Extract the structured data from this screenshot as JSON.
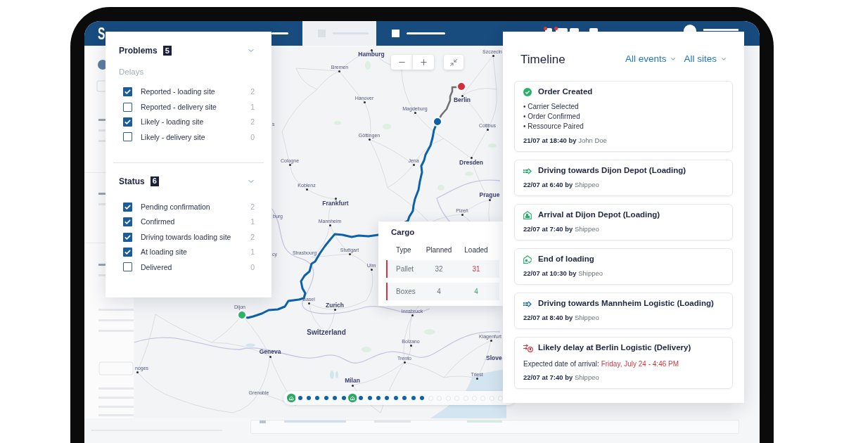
{
  "nav": {
    "logo": "S",
    "tabs": [
      {
        "selected": false
      },
      {
        "selected": true
      },
      {
        "selected": false
      }
    ],
    "icons": [
      {
        "alert": true
      },
      {
        "alert": true
      },
      {
        "alert": false
      },
      {
        "alert": false
      }
    ]
  },
  "filters": {
    "sections": [
      {
        "title": "Problems",
        "count": "5",
        "expanded": true,
        "subheading": "Delays",
        "items": [
          {
            "label": "Reported - loading site",
            "count": "2",
            "checked": true
          },
          {
            "label": "Reported - delivery site",
            "count": "1",
            "checked": false
          },
          {
            "label": "Likely - loading site",
            "count": "2",
            "checked": true
          },
          {
            "label": "Likely - delivery site",
            "count": "0",
            "checked": false
          }
        ]
      },
      {
        "title": "Status",
        "count": "6",
        "expanded": true,
        "items": [
          {
            "label": "Pending confirmation",
            "count": "2",
            "checked": true
          },
          {
            "label": "Confirmed",
            "count": "1",
            "checked": true
          },
          {
            "label": "Driving towards loading site",
            "count": "2",
            "checked": true
          },
          {
            "label": "At loading site",
            "count": "1",
            "checked": true
          },
          {
            "label": "Delivered",
            "count": "0",
            "checked": false
          }
        ]
      }
    ]
  },
  "map": {
    "labels": [
      {
        "text": "Hamburg",
        "kind": "major"
      },
      {
        "text": "Bremen",
        "kind": "minor"
      },
      {
        "text": "Hanover",
        "kind": "minor"
      },
      {
        "text": "Magdeburg",
        "kind": "minor"
      },
      {
        "text": "Berlin",
        "kind": "major"
      },
      {
        "text": "Szczecin",
        "kind": "minor"
      },
      {
        "text": "s",
        "kind": "minor"
      },
      {
        "text": "Cottbus",
        "kind": "minor"
      },
      {
        "text": "Göttingen",
        "kind": "minor"
      },
      {
        "text": "Cologne",
        "kind": "minor"
      },
      {
        "text": "Jena",
        "kind": "minor"
      },
      {
        "text": "Dresden",
        "kind": "major"
      },
      {
        "text": "Koblenz",
        "kind": "minor"
      },
      {
        "text": "Frankfurt",
        "kind": "major"
      },
      {
        "text": "Prague",
        "kind": "major"
      },
      {
        "text": "Plzeň",
        "kind": "minor"
      },
      {
        "text": "Mannheim",
        "kind": "minor"
      },
      {
        "text": "Stuttgart",
        "kind": "minor"
      },
      {
        "text": "Strasbourg",
        "kind": "minor"
      },
      {
        "text": "Ulm",
        "kind": "minor"
      },
      {
        "text": "burg",
        "kind": "minor"
      },
      {
        "text": "cy",
        "kind": "minor"
      },
      {
        "text": "Basel",
        "kind": "minor"
      },
      {
        "text": "Zurich",
        "kind": "major"
      },
      {
        "text": "Dijon",
        "kind": "minor"
      },
      {
        "text": "Switzerland",
        "kind": "country"
      },
      {
        "text": "Geneva",
        "kind": "major"
      },
      {
        "text": "Innsbruck",
        "kind": "minor"
      },
      {
        "text": "Bolzano",
        "kind": "minor"
      },
      {
        "text": "Klagenfurt",
        "kind": "minor"
      },
      {
        "text": "Trento",
        "kind": "minor"
      },
      {
        "text": "Slove",
        "kind": "major"
      },
      {
        "text": "Triest",
        "kind": "minor"
      },
      {
        "text": "Milan",
        "kind": "major"
      },
      {
        "text": "Grenoble",
        "kind": "minor"
      },
      {
        "text": "noges",
        "kind": "minor"
      }
    ],
    "progress": [
      {
        "kind": "stop"
      },
      {
        "kind": "done"
      },
      {
        "kind": "done"
      },
      {
        "kind": "done"
      },
      {
        "kind": "done"
      },
      {
        "kind": "done"
      },
      {
        "kind": "done"
      },
      {
        "kind": "stop"
      },
      {
        "kind": "done"
      },
      {
        "kind": "done"
      },
      {
        "kind": "done"
      },
      {
        "kind": "done"
      },
      {
        "kind": "done"
      },
      {
        "kind": "done"
      },
      {
        "kind": "done"
      },
      {
        "kind": "done"
      },
      {
        "kind": "pending"
      },
      {
        "kind": "pending"
      },
      {
        "kind": "pending"
      },
      {
        "kind": "pending"
      },
      {
        "kind": "pending"
      },
      {
        "kind": "pending"
      },
      {
        "kind": "pending"
      },
      {
        "kind": "pending"
      },
      {
        "kind": "pending"
      }
    ]
  },
  "cargo": {
    "title": "Cargo",
    "columns": [
      "Type",
      "Planned",
      "Loaded"
    ],
    "rows": [
      {
        "type": "Pallet",
        "planned": "32",
        "loaded": "31",
        "complete": false
      },
      {
        "type": "Boxes",
        "planned": "4",
        "loaded": "4",
        "complete": true
      }
    ]
  },
  "timeline": {
    "title": "Timeline",
    "filters": [
      "All events",
      "All sites"
    ],
    "events": [
      {
        "kind": "created",
        "color": "#2bb06a",
        "title": "Order Created",
        "details": [
          "• Carrier Selected",
          "• Order Confirmed",
          "• Ressource Paired"
        ],
        "date": "21/07 at 18:40 by",
        "author": "John Doe"
      },
      {
        "kind": "driving",
        "color": "#2bb06a",
        "title": "Driving towards Dijon Depot (Loading)",
        "date": "22/07 at 6:40 by",
        "author": "Shippeo"
      },
      {
        "kind": "arrival",
        "color": "#2bb06a",
        "title": "Arrival at Dijon Depot (Loading)",
        "date": "22/07 at 7:40 by",
        "author": "Shippeo"
      },
      {
        "kind": "loaded",
        "color": "#2bb06a",
        "title": "End of loading",
        "date": "22/07 at 10:30 by",
        "author": "Shippeo"
      },
      {
        "kind": "driving",
        "color": "#1f74c0",
        "title": "Driving towards Mannheim Logistic (Loading)",
        "date": "22/07 at 8:40 by",
        "author": "Shippeo"
      },
      {
        "kind": "delay",
        "color": "#d9343f",
        "title": "Likely delay at Berlin Logistic (Delivery)",
        "note": {
          "label": "Expected date of arrival:",
          "value": "Friday, July 24 - 4:46 PM"
        },
        "date": "22/07 at 7:40 by",
        "author": "Shippeo"
      }
    ]
  }
}
